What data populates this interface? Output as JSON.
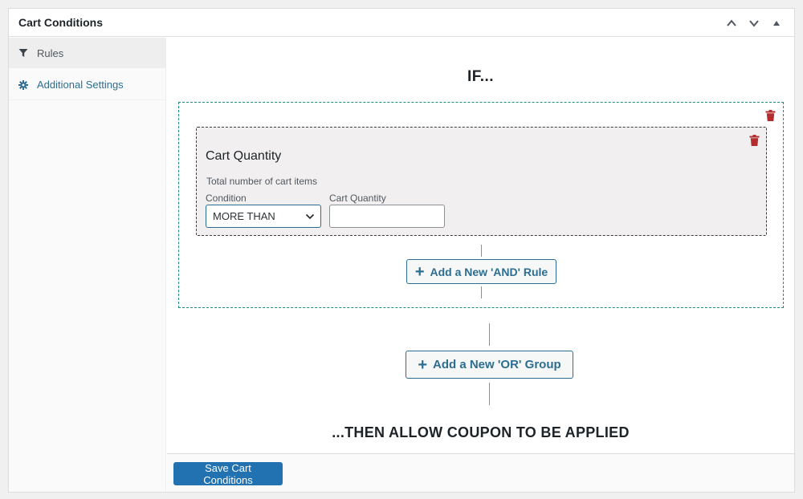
{
  "panel": {
    "title": "Cart Conditions",
    "controls": {
      "move_up_icon": "chevron-up-icon",
      "move_down_icon": "chevron-down-icon",
      "toggle_icon": "triangle-up-icon"
    }
  },
  "sidebar": {
    "tabs": [
      {
        "label": "Rules",
        "icon": "filter-icon",
        "active": true
      },
      {
        "label": "Additional Settings",
        "icon": "gear-icon",
        "active": false
      }
    ]
  },
  "main": {
    "if_label": "IF...",
    "group": {
      "rule": {
        "title": "Cart Quantity",
        "description": "Total number of cart items",
        "condition_label": "Condition",
        "condition_value": "MORE THAN",
        "quantity_label": "Cart Quantity",
        "quantity_value": ""
      },
      "add_and_label": "Add a New 'AND' Rule"
    },
    "add_or_label": "Add a New 'OR' Group",
    "then_label": "...THEN ALLOW COUPON TO BE APPLIED"
  },
  "footer": {
    "save_label": "Save Cart Conditions"
  },
  "colors": {
    "accent": "#2c6e91",
    "primary_button": "#2271b1",
    "delete": "#b32d2e",
    "group_border": "#1e8a7a"
  }
}
